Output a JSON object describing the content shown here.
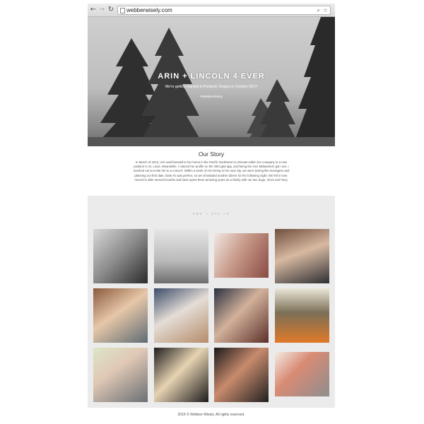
{
  "browser": {
    "url": "webberwisely.com",
    "nav_back": "←",
    "nav_forward": "→",
    "reload": "↻",
    "search_icon": "search-icon",
    "bookmark_icon": "star-icon"
  },
  "hero": {
    "title": "ARIN + LINCOLN 4 EVER",
    "subtitle": "We're getting married in Portland, Oregon in October 2017!",
    "hashtag": "#WebberWisely"
  },
  "story": {
    "title": "Our Story",
    "text": "In March of 2013, Arin said farewell to her home in the Pacific Northwest to relocate within her company to a new position in St. Louis. Meanwhile, I noticed her profile on the OkCupid app, and being the nice Midwestern gal I am, I reached out to invite her to a concert. Within a week of Arin being in her new city, we were texting like teenagers and planning our first date. Date #1 was perfect, so we scheduled another dinner for the following night. We fell in love, moved in after several months and have spent three amazing years as a family with our two dogs, Vince and Tony."
  },
  "gallery": {
    "label": "PDX + STL <3",
    "photos": [
      "photo-1",
      "photo-2",
      "photo-3",
      "photo-4",
      "photo-5",
      "photo-6",
      "photo-7",
      "photo-8",
      "photo-9",
      "photo-10",
      "photo-11",
      "photo-12"
    ]
  },
  "footer": {
    "text": "2016 © Webber-Wisely. All rights reserved."
  }
}
